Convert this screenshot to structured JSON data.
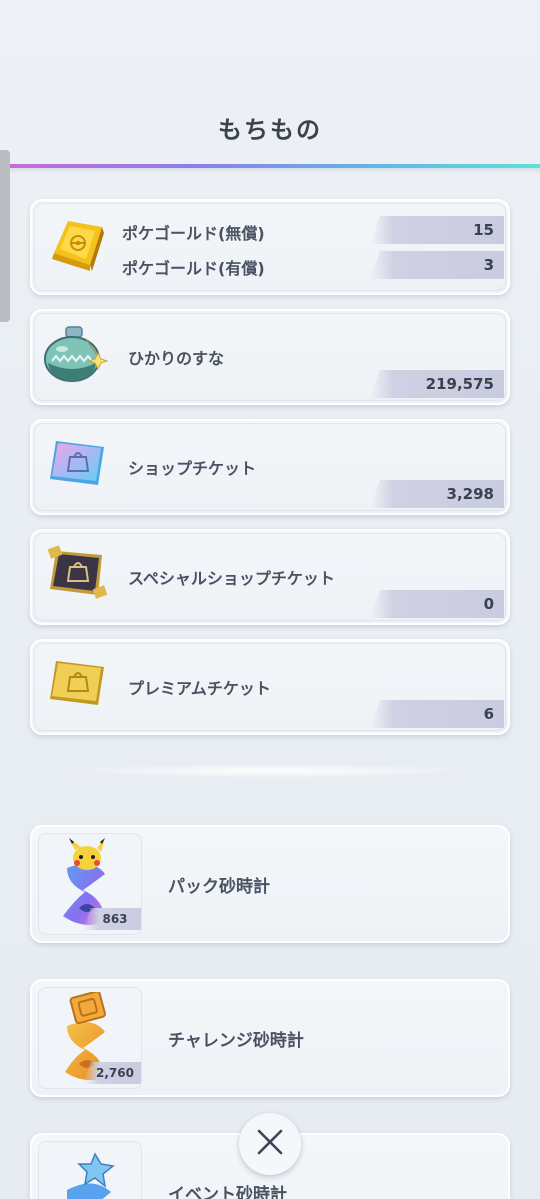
{
  "header": {
    "title": "もちもの"
  },
  "currencies": [
    {
      "label_free": "ポケゴールド(無償)",
      "value_free": "15",
      "label_paid": "ポケゴールド(有償)",
      "value_paid": "3",
      "icon": "gold-bar-icon"
    },
    {
      "label": "ひかりのすな",
      "value": "219,575",
      "icon": "shining-sand-bottle-icon"
    },
    {
      "label": "ショップチケット",
      "value": "3,298",
      "icon": "shop-ticket-icon"
    },
    {
      "label": "スペシャルショップチケット",
      "value": "0",
      "icon": "special-shop-ticket-icon"
    },
    {
      "label": "プレミアムチケット",
      "value": "6",
      "icon": "premium-ticket-icon"
    }
  ],
  "hourglasses": [
    {
      "label": "パック砂時計",
      "count": "863",
      "icon": "pack-hourglass-icon"
    },
    {
      "label": "チャレンジ砂時計",
      "count": "2,760",
      "icon": "challenge-hourglass-icon"
    },
    {
      "label": "イベント砂時計",
      "count": "",
      "icon": "event-hourglass-icon"
    }
  ],
  "controls": {
    "close_icon": "close-icon"
  },
  "colors": {
    "accent_gradient": [
      "#c86bd8",
      "#62b7e6",
      "#5fe0d8"
    ],
    "value_bar": "#cfd0e3"
  }
}
